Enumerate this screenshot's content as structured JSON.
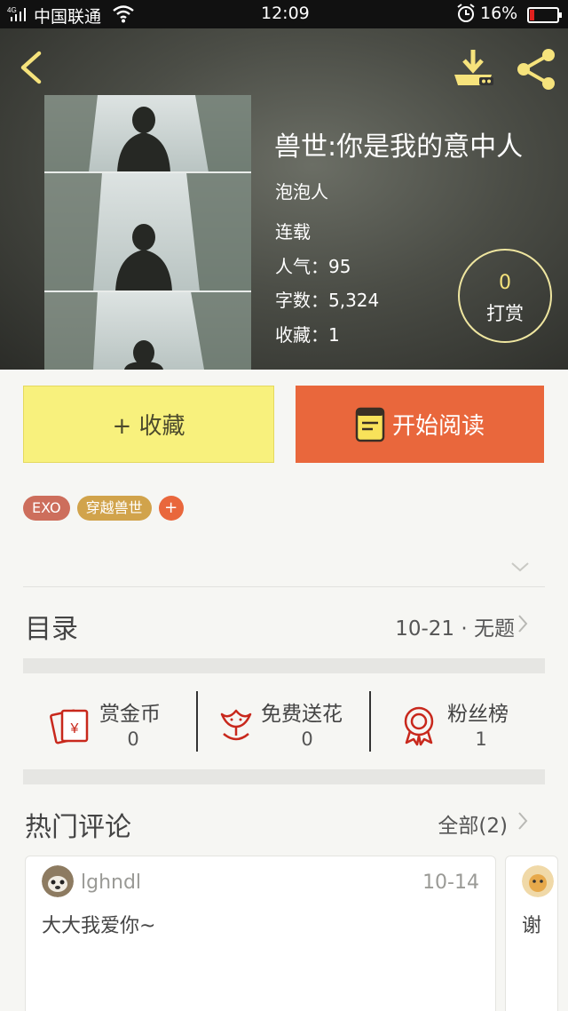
{
  "status_bar": {
    "signal": "4G",
    "carrier": "中国联通",
    "time": "12:09",
    "battery": "16%",
    "battery_fraction": 0.16
  },
  "book": {
    "title": "兽世:你是我的意中人",
    "author": "泡泡人",
    "status": "连载",
    "popularity": "人气：95",
    "word_count": "字数：5,324",
    "favorites": "收藏：1"
  },
  "reward": {
    "count": "0",
    "label": "打赏"
  },
  "buttons": {
    "collect": "+ 收藏",
    "read": "开始阅读"
  },
  "tags": [
    "EXO",
    "穿越兽世",
    "+"
  ],
  "directory": {
    "title": "目录",
    "latest": "10-21 · 无题"
  },
  "stats": [
    {
      "label": "赏金币",
      "value": "0",
      "icon": "red-envelope-icon"
    },
    {
      "label": "免费送花",
      "value": "0",
      "icon": "flower-icon"
    },
    {
      "label": "粉丝榜",
      "value": "1",
      "icon": "medal-icon"
    }
  ],
  "hot_comments": {
    "title": "热门评论",
    "all_label": "全部(2)",
    "items": [
      {
        "user": "lghndl",
        "date": "10-14",
        "text": "大大我爱你~"
      },
      {
        "user": "",
        "date": "",
        "text": "谢"
      }
    ]
  },
  "colors": {
    "accent_orange": "#e9673c",
    "collect_yellow": "#f8f17d",
    "tag_exo": "#cd6e5c",
    "tag_gold": "#d1a34b",
    "icon_red": "#c8281c",
    "header_yellow": "#f6e37c"
  }
}
